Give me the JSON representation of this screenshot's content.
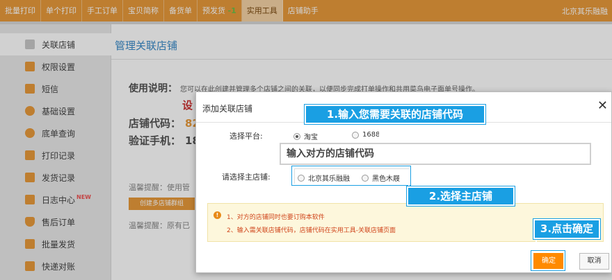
{
  "nav": {
    "items": [
      {
        "label": "批量打印"
      },
      {
        "label": "单个打印"
      },
      {
        "label": "手工订单"
      },
      {
        "label": "宝贝简称"
      },
      {
        "label": "备货单"
      },
      {
        "label": "预发货",
        "count": "-1"
      },
      {
        "label": "实用工具",
        "active": true
      },
      {
        "label": "店铺助手"
      }
    ],
    "right_text": "北京其乐融融"
  },
  "sidebar": {
    "items": [
      {
        "label": "关联店铺",
        "icon": "link-icon",
        "active": true
      },
      {
        "label": "权限设置",
        "icon": "lock-icon"
      },
      {
        "label": "短信",
        "icon": "sms-icon"
      },
      {
        "label": "基础设置",
        "icon": "gear-icon"
      },
      {
        "label": "底单查询",
        "icon": "search-icon"
      },
      {
        "label": "打印记录",
        "icon": "printer-icon"
      },
      {
        "label": "发货记录",
        "icon": "truck-icon"
      },
      {
        "label": "日志中心",
        "icon": "log-icon",
        "badge": "NEW"
      },
      {
        "label": "售后订单",
        "icon": "shield-icon"
      },
      {
        "label": "批量发货",
        "icon": "batch-icon"
      },
      {
        "label": "快递对账",
        "icon": "ledger-icon"
      }
    ]
  },
  "main": {
    "title": "管理关联店铺",
    "usage_label": "使用说明：",
    "usage_desc": "您可以在此创建并管理多个店铺之间的关联，以便同步完成打单操作和共用菜鸟电子面单号操作。",
    "bg_partial": "设",
    "shop_code_label": "店铺代码：",
    "shop_code_value": "82",
    "verify_phone_label": "验证手机：",
    "verify_phone_value": "18",
    "tip1": "温馨提醒：使用管",
    "bg_button": "创建多店铺群组",
    "tip2": "温馨提醒：原有已"
  },
  "dialog": {
    "title": "添加关联店铺",
    "close": "✕",
    "platform_label": "选择平台:",
    "platform_options": [
      {
        "label": "淘宝",
        "checked": true
      },
      {
        "label": "1688",
        "checked": false
      }
    ],
    "code_input_text": "输入对方的店铺代码",
    "main_shop_label": "请选择主店铺:",
    "main_shop_options": [
      {
        "label": "北京其乐融融",
        "checked": false
      },
      {
        "label": "黑色木屐",
        "checked": false
      }
    ],
    "notice_lines": [
      "1、对方的店铺同时也要订购本软件",
      "2、输入需关联店铺代码，店铺代码在实用工具-关联店铺页面"
    ],
    "ok_button": "确定",
    "cancel_button": "取消"
  },
  "callouts": {
    "step1": "1.输入您需要关联的店铺代码",
    "step2": "2.选择主店铺",
    "step3": "3.点击确定"
  },
  "colors": {
    "nav_bg": "#e89a3b",
    "callout_blue": "#1a9fe3",
    "ok_orange": "#ff8a00",
    "title_blue": "#3a8ac8"
  }
}
